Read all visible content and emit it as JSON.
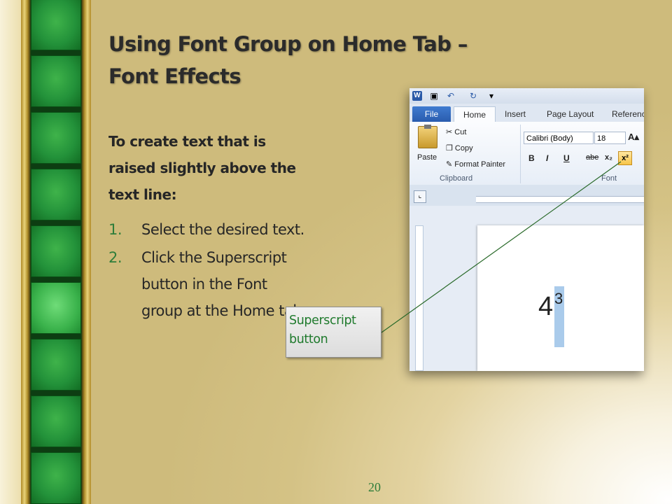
{
  "slide": {
    "title_line1": "Using Font Group on Home Tab –",
    "title_line2": "Font Effects",
    "intro_line1": "To create text that is",
    "intro_line2": "raised slightly above the",
    "intro_line3": "text line:",
    "steps": [
      {
        "num": "1.",
        "lines": [
          "Select the desired text."
        ]
      },
      {
        "num": "2.",
        "lines": [
          "Click the Superscript",
          "button in the Font",
          "group at the Home tab."
        ]
      }
    ],
    "callout_line1": "Superscript",
    "callout_line2": "button",
    "page_number": "20"
  },
  "word": {
    "qat": {
      "logo": "W",
      "icons": [
        "save-icon",
        "undo-icon",
        "redo-icon",
        "customize-icon"
      ]
    },
    "tabs": [
      "File",
      "Home",
      "Insert",
      "Page Layout",
      "Referenc"
    ],
    "clipboard": {
      "paste": "Paste",
      "cut": "Cut",
      "copy": "Copy",
      "format_painter": "Format Painter",
      "group_label": "Clipboard"
    },
    "font": {
      "family": "Calibri (Body)",
      "size": "18",
      "group_label": "Font",
      "buttons": [
        "B",
        "I",
        "U",
        "abe",
        "x₂",
        "x²"
      ]
    },
    "document": {
      "base": "4",
      "superscript": "3"
    }
  },
  "colors": {
    "title": "#2b2b2b",
    "accent_green": "#2e7d3a",
    "strip_green": "#0d3d12",
    "highlight": "#aacbeb"
  }
}
